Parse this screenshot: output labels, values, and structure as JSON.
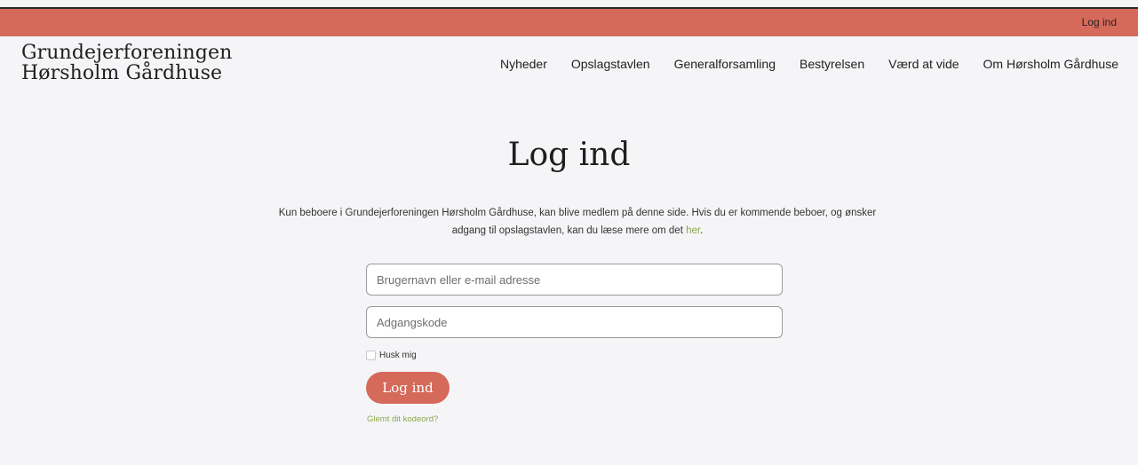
{
  "topbar": {
    "login_link": "Log ind",
    "color": "#d56a5b"
  },
  "brand": {
    "line1": "Grundejerforeningen",
    "line2": "Hørsholm Gårdhuse"
  },
  "nav": {
    "items": [
      "Nyheder",
      "Opslagstavlen",
      "Generalforsamling",
      "Bestyrelsen",
      "Værd at vide",
      "Om Hørsholm Gårdhuse"
    ]
  },
  "main": {
    "title": "Log ind",
    "intro_text": "Kun beboere i Grundejerforeningen Hørsholm Gårdhuse, kan blive medlem på denne side. Hvis du er kommende beboer, og ønsker adgang til opslagstavlen, kan du læse mere om det ",
    "intro_link": "her",
    "intro_end": "."
  },
  "form": {
    "username_placeholder": "Brugernavn eller e-mail adresse",
    "username_value": "",
    "password_placeholder": "Adgangskode",
    "password_value": "",
    "remember_label": "Husk mig",
    "remember_checked": false,
    "submit_label": "Log ind",
    "forgot_link": "Glemt dit kodeord?"
  },
  "colors": {
    "accent": "#d56a5b",
    "link": "#8aa84a",
    "background": "#f5f5f7"
  }
}
